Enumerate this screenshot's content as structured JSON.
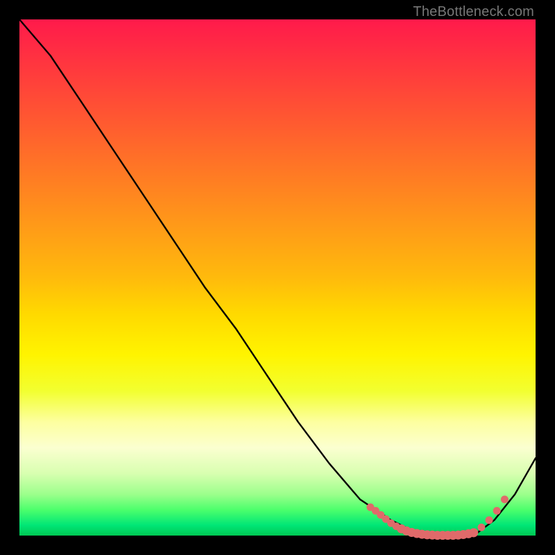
{
  "watermark": "TheBottleneck.com",
  "chart_data": {
    "type": "line",
    "title": "",
    "xlabel": "",
    "ylabel": "",
    "xlim": [
      0,
      100
    ],
    "ylim": [
      0,
      100
    ],
    "grid": false,
    "legend": false,
    "series": [
      {
        "name": "curve",
        "color": "#000000",
        "x": [
          0,
          6,
          12,
          18,
          24,
          30,
          36,
          42,
          48,
          54,
          60,
          66,
          72,
          76,
          80,
          84,
          88,
          92,
          96,
          100
        ],
        "y": [
          100,
          93,
          84,
          75,
          66,
          57,
          48,
          40,
          31,
          22,
          14,
          7,
          3,
          1,
          0,
          0,
          0,
          3,
          8,
          15
        ]
      }
    ],
    "markers": {
      "name": "highlight-dots",
      "color": "#e06a6a",
      "points": [
        {
          "x": 68,
          "y": 5.5
        },
        {
          "x": 69,
          "y": 4.8
        },
        {
          "x": 70,
          "y": 4.0
        },
        {
          "x": 71,
          "y": 3.2
        },
        {
          "x": 72,
          "y": 2.4
        },
        {
          "x": 73,
          "y": 1.8
        },
        {
          "x": 74,
          "y": 1.3
        },
        {
          "x": 75,
          "y": 0.9
        },
        {
          "x": 76,
          "y": 0.6
        },
        {
          "x": 77,
          "y": 0.4
        },
        {
          "x": 78,
          "y": 0.25
        },
        {
          "x": 79,
          "y": 0.15
        },
        {
          "x": 80,
          "y": 0.1
        },
        {
          "x": 81,
          "y": 0.05
        },
        {
          "x": 82,
          "y": 0.05
        },
        {
          "x": 83,
          "y": 0.05
        },
        {
          "x": 84,
          "y": 0.05
        },
        {
          "x": 85,
          "y": 0.1
        },
        {
          "x": 86,
          "y": 0.2
        },
        {
          "x": 87,
          "y": 0.35
        },
        {
          "x": 88,
          "y": 0.55
        },
        {
          "x": 89.5,
          "y": 1.6
        },
        {
          "x": 91,
          "y": 3.0
        },
        {
          "x": 92.5,
          "y": 4.8
        },
        {
          "x": 94,
          "y": 7.0
        }
      ]
    },
    "gradient_stops": [
      {
        "pos": 0,
        "color": "#ff1a4b"
      },
      {
        "pos": 50,
        "color": "#ffd900"
      },
      {
        "pos": 78,
        "color": "#fdffa0"
      },
      {
        "pos": 100,
        "color": "#00c853"
      }
    ]
  }
}
